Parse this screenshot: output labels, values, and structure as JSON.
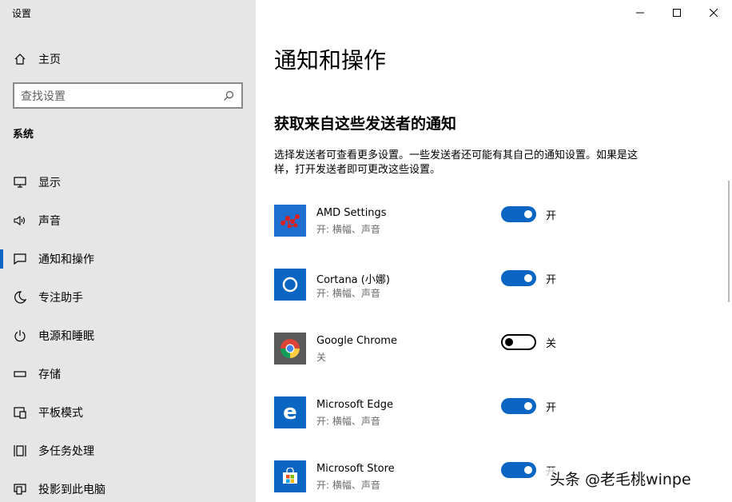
{
  "window": {
    "title": "设置"
  },
  "sidebar": {
    "home_label": "主页",
    "search_placeholder": "查找设置",
    "section_label": "系统",
    "items": [
      {
        "label": "显示",
        "icon": "monitor-icon",
        "active": false
      },
      {
        "label": "声音",
        "icon": "speaker-icon",
        "active": false
      },
      {
        "label": "通知和操作",
        "icon": "notification-icon",
        "active": true
      },
      {
        "label": "专注助手",
        "icon": "moon-icon",
        "active": false
      },
      {
        "label": "电源和睡眠",
        "icon": "power-icon",
        "active": false
      },
      {
        "label": "存储",
        "icon": "storage-icon",
        "active": false
      },
      {
        "label": "平板模式",
        "icon": "tablet-mode-icon",
        "active": false
      },
      {
        "label": "多任务处理",
        "icon": "multitask-icon",
        "active": false
      },
      {
        "label": "投影到此电脑",
        "icon": "project-icon",
        "active": false
      }
    ]
  },
  "main": {
    "title": "通知和操作",
    "subtitle": "获取来自这些发送者的通知",
    "description": "选择发送者可查看更多设置。一些发送者还可能有其自己的通知设置。如果是这样，打开发送者即可更改这些设置。",
    "apps": [
      {
        "name": "AMD Settings",
        "sub": "开: 横幅、声音",
        "toggle_on": true,
        "toggle_label": "开",
        "icon": "amd-settings-icon",
        "icon_bg": "#1f6fd0"
      },
      {
        "name": "Cortana (小娜)",
        "sub": "开: 横幅、声音",
        "toggle_on": true,
        "toggle_label": "开",
        "icon": "cortana-icon",
        "icon_bg": "#0a66c2"
      },
      {
        "name": "Google Chrome",
        "sub": "关",
        "toggle_on": false,
        "toggle_label": "关",
        "icon": "chrome-icon",
        "icon_bg": "#5a5a5a"
      },
      {
        "name": "Microsoft Edge",
        "sub": "开: 横幅、声音",
        "toggle_on": true,
        "toggle_label": "开",
        "icon": "edge-icon",
        "icon_bg": "#0a66c2"
      },
      {
        "name": "Microsoft Store",
        "sub": "开: 横幅、声音",
        "toggle_on": true,
        "toggle_label": "开",
        "icon": "store-icon",
        "icon_bg": "#0a66c2"
      }
    ]
  },
  "colors": {
    "accent": "#0a66c2",
    "sidebar_bg": "#e6e6e6"
  },
  "watermark": "头条 @老毛桃winpe"
}
